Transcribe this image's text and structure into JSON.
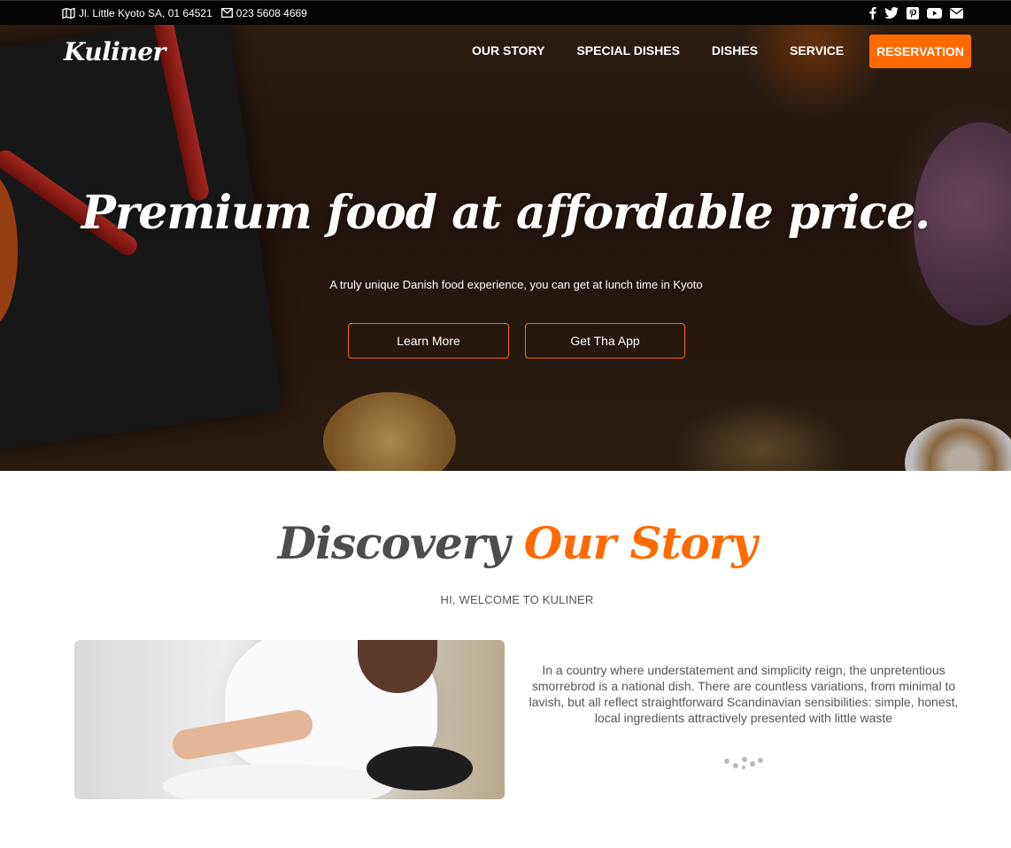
{
  "topbar": {
    "address": "Jl. Little Kyoto SA, 01 64521",
    "phone": "023 5608 4669",
    "socials": [
      "facebook-icon",
      "twitter-icon",
      "pinterest-icon",
      "youtube-icon",
      "email-icon"
    ]
  },
  "header": {
    "logo": "Kuliner",
    "nav": [
      "OUR STORY",
      "SPECIAL DISHES",
      "DISHES",
      "SERVICE"
    ],
    "cta": "RESERVATION"
  },
  "hero": {
    "title": "Premium food at affordable price.",
    "subtitle": "A truly unique Danish food experience, you can get at lunch time in Kyoto",
    "buttons": [
      "Learn More",
      "Get Tha App"
    ]
  },
  "story": {
    "title_part1": "Discovery",
    "title_part2": "Our Story",
    "subtitle": "HI, WELCOME TO KULINER",
    "text": "In a country where understatement and simplicity reign, the unpretentious smorrebrod is a national dish. There are countless variations, from minimal to lavish, but all reflect straightforward Scandinavian sensibilities: simple, honest, local ingredients attractively presented with little waste"
  },
  "colors": {
    "accent": "#ff6a00",
    "topbar": "#050505",
    "heading": "#4d4d4d"
  }
}
